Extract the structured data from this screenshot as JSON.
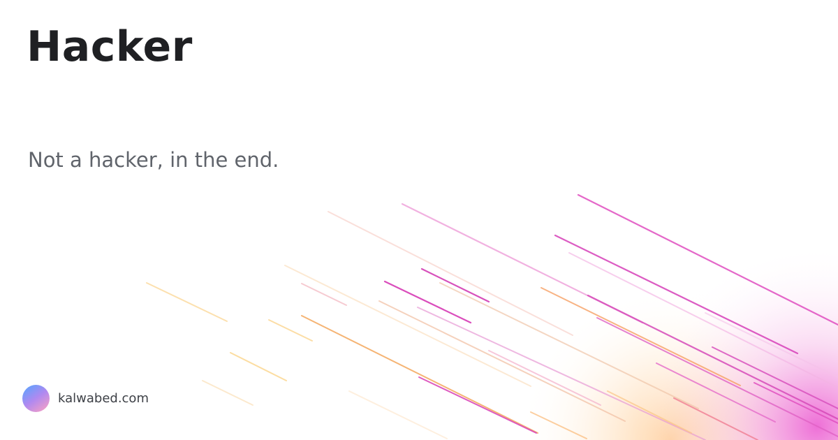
{
  "title": "Hacker",
  "subtitle": "Not a hacker, in the end.",
  "site": "kalwabed.com"
}
